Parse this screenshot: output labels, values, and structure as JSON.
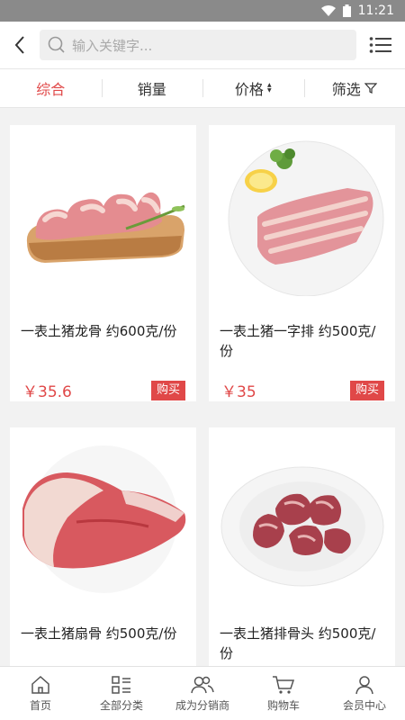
{
  "status": {
    "time": "11:21"
  },
  "search": {
    "placeholder": "输入关键字..."
  },
  "sort": {
    "items": [
      "综合",
      "销量",
      "价格",
      "筛选"
    ]
  },
  "products": [
    {
      "name": "一表土猪龙骨 约600克/份",
      "price": "￥35.6",
      "buy": "购买"
    },
    {
      "name": "一表土猪一字排 约500克/份",
      "price": "￥35",
      "buy": "购买"
    },
    {
      "name": "一表土猪扇骨 约500克/份",
      "price": "",
      "buy": ""
    },
    {
      "name": "一表土猪排骨头 约500克/份",
      "price": "",
      "buy": ""
    }
  ],
  "tabs": [
    "首页",
    "全部分类",
    "成为分销商",
    "购物车",
    "会员中心"
  ],
  "colors": {
    "accent": "#e04848"
  }
}
